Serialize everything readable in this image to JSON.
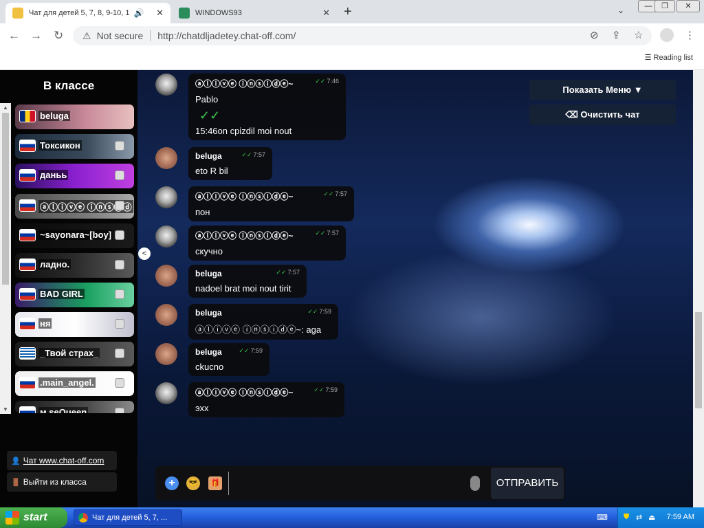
{
  "browser": {
    "tabs": [
      {
        "title": "Чат для детей 5, 7, 8, 9-10, 1",
        "active": true,
        "icon": "chat-favicon"
      },
      {
        "title": "WINDOWS93",
        "active": false,
        "icon": "windows93-favicon"
      }
    ],
    "new_tab": "+",
    "address": {
      "security": "Not secure",
      "url": "http://chatdljadetey.chat-off.com/"
    },
    "reading_list": "Reading list"
  },
  "sidebar": {
    "title": "В классе",
    "users": [
      {
        "name": "beluga",
        "flag": "romania",
        "colors": [
          "#002b7f",
          "#fcd116",
          "#ce1126"
        ]
      },
      {
        "name": "Токсикон",
        "flag": "russia",
        "colors": [
          "#ffffff",
          "#0039a6",
          "#d52b1e"
        ]
      },
      {
        "name": "даньь",
        "flag": "russia",
        "colors": [
          "#ffffff",
          "#0039a6",
          "#d52b1e"
        ]
      },
      {
        "name": "ⓐⓛⓘⓥⓔ ⓘⓝⓢⓘⓓ",
        "flag": "russia",
        "colors": [
          "#ffffff",
          "#0039a6",
          "#d52b1e"
        ]
      },
      {
        "name": "~sayonara~[boy]",
        "flag": "russia",
        "colors": [
          "#ffffff",
          "#0039a6",
          "#d52b1e"
        ]
      },
      {
        "name": "ладно.",
        "flag": "russia",
        "colors": [
          "#ffffff",
          "#0039a6",
          "#d52b1e"
        ]
      },
      {
        "name": "BAD GIRL",
        "flag": "russia",
        "colors": [
          "#ffffff",
          "#0039a6",
          "#d52b1e"
        ]
      },
      {
        "name": "ня",
        "flag": "russia",
        "colors": [
          "#ffffff",
          "#0039a6",
          "#d52b1e"
        ]
      },
      {
        "name": "_Твой страх_",
        "flag": "greece",
        "colors": [
          "#0d5eaf",
          "#ffffff",
          "#0d5eaf"
        ]
      },
      {
        "name": ".main_angel.",
        "flag": "russia",
        "colors": [
          "#ffffff",
          "#0039a6",
          "#d52b1e"
        ]
      },
      {
        "name": "м seQueen",
        "flag": "russia",
        "colors": [
          "#ffffff",
          "#0039a6",
          "#d52b1e"
        ]
      }
    ],
    "link_chat": "Чат www.chat-off.com",
    "exit": "Выйти из класса"
  },
  "top_buttons": {
    "menu": "Показать Меню ▼",
    "clear": "Очистить чат"
  },
  "messages": [
    {
      "author": "ⓐⓛⓘⓥⓔ ⓘⓝⓢⓘⓓⓔ~",
      "time": "7:46",
      "lines": [
        "Pablo",
        "15:46on cpizdil moi nout"
      ],
      "avatar": "pablo"
    },
    {
      "author": "beluga",
      "time": "7:57",
      "lines": [
        "eto R bil"
      ],
      "avatar": "beluga"
    },
    {
      "author": "ⓐⓛⓘⓥⓔ ⓘⓝⓢⓘⓓⓔ~",
      "time": "7:57",
      "lines": [
        "пон"
      ],
      "avatar": "pablo"
    },
    {
      "author": "ⓐⓛⓘⓥⓔ ⓘⓝⓢⓘⓓⓔ~",
      "time": "7:57",
      "lines": [
        "скучно"
      ],
      "avatar": "pablo"
    },
    {
      "author": "beluga",
      "time": "7:57",
      "lines": [
        "nadoel brat moi nout tirit"
      ],
      "avatar": "beluga"
    },
    {
      "author": "beluga",
      "time": "7:59",
      "lines": [
        "ⓐⓛⓘⓥⓔ ⓘⓝⓢⓘⓓⓔ~: aga"
      ],
      "avatar": "beluga"
    },
    {
      "author": "beluga",
      "time": "7:59",
      "lines": [
        "ckucno"
      ],
      "avatar": "beluga"
    },
    {
      "author": "ⓐⓛⓘⓥⓔ ⓘⓝⓢⓘⓓⓔ~",
      "time": "7:59",
      "lines": [
        "эхх"
      ],
      "avatar": "pablo"
    }
  ],
  "input": {
    "value": "",
    "send": "ОТПРАВИТЬ"
  },
  "taskbar": {
    "start": "start",
    "task": "Чат для детей 5, 7, ...",
    "clock": "7:59 AM"
  }
}
